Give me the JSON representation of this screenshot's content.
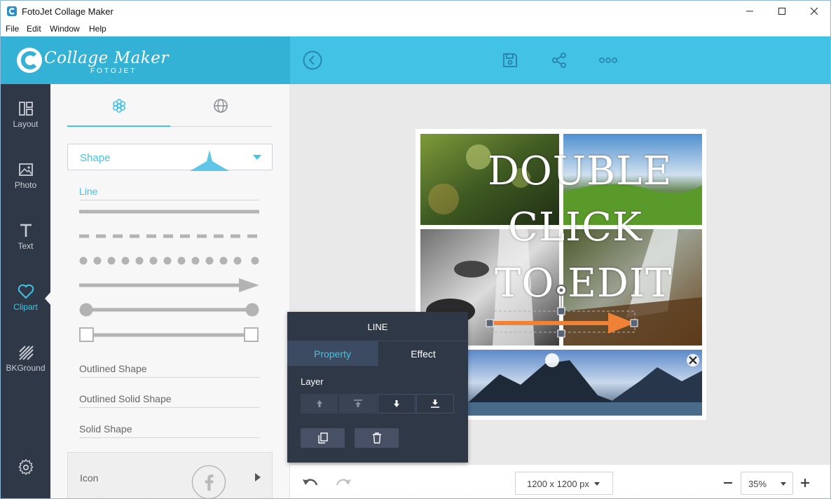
{
  "window": {
    "title": "FotoJet Collage Maker"
  },
  "menu": {
    "items": [
      "File",
      "Edit",
      "Window",
      "Help"
    ]
  },
  "logo": {
    "text": "Collage Maker",
    "sub": "FOTOJET"
  },
  "header": {
    "icons": [
      "back-icon",
      "save-icon",
      "share-icon",
      "more-icon"
    ]
  },
  "rail": {
    "items": [
      {
        "label": "Layout",
        "icon": "layout-icon"
      },
      {
        "label": "Photo",
        "icon": "photo-icon"
      },
      {
        "label": "Text",
        "icon": "text-icon"
      },
      {
        "label": "Clipart",
        "icon": "heart-icon",
        "active": true
      },
      {
        "label": "BKGround",
        "icon": "background-icon"
      }
    ],
    "settings_icon": "gear-icon"
  },
  "panel": {
    "category": "Shape",
    "sections": {
      "line": "Line",
      "outlined": "Outlined Shape",
      "outlined_solid": "Outlined Solid Shape",
      "solid": "Solid Shape"
    },
    "icon_card": "Icon"
  },
  "canvas": {
    "text_lines": [
      "DOUBLE",
      "CLICK",
      "TO EDIT"
    ],
    "arrow_color": "#f08238"
  },
  "popup": {
    "title": "LINE",
    "tabs": [
      "Property",
      "Effect"
    ],
    "layer_label": "Layer"
  },
  "bottom": {
    "canvas_size": "1200 x 1200 px",
    "zoom": "35%"
  },
  "colors": {
    "accent": "#42c2e5",
    "dark": "#2f3847"
  }
}
